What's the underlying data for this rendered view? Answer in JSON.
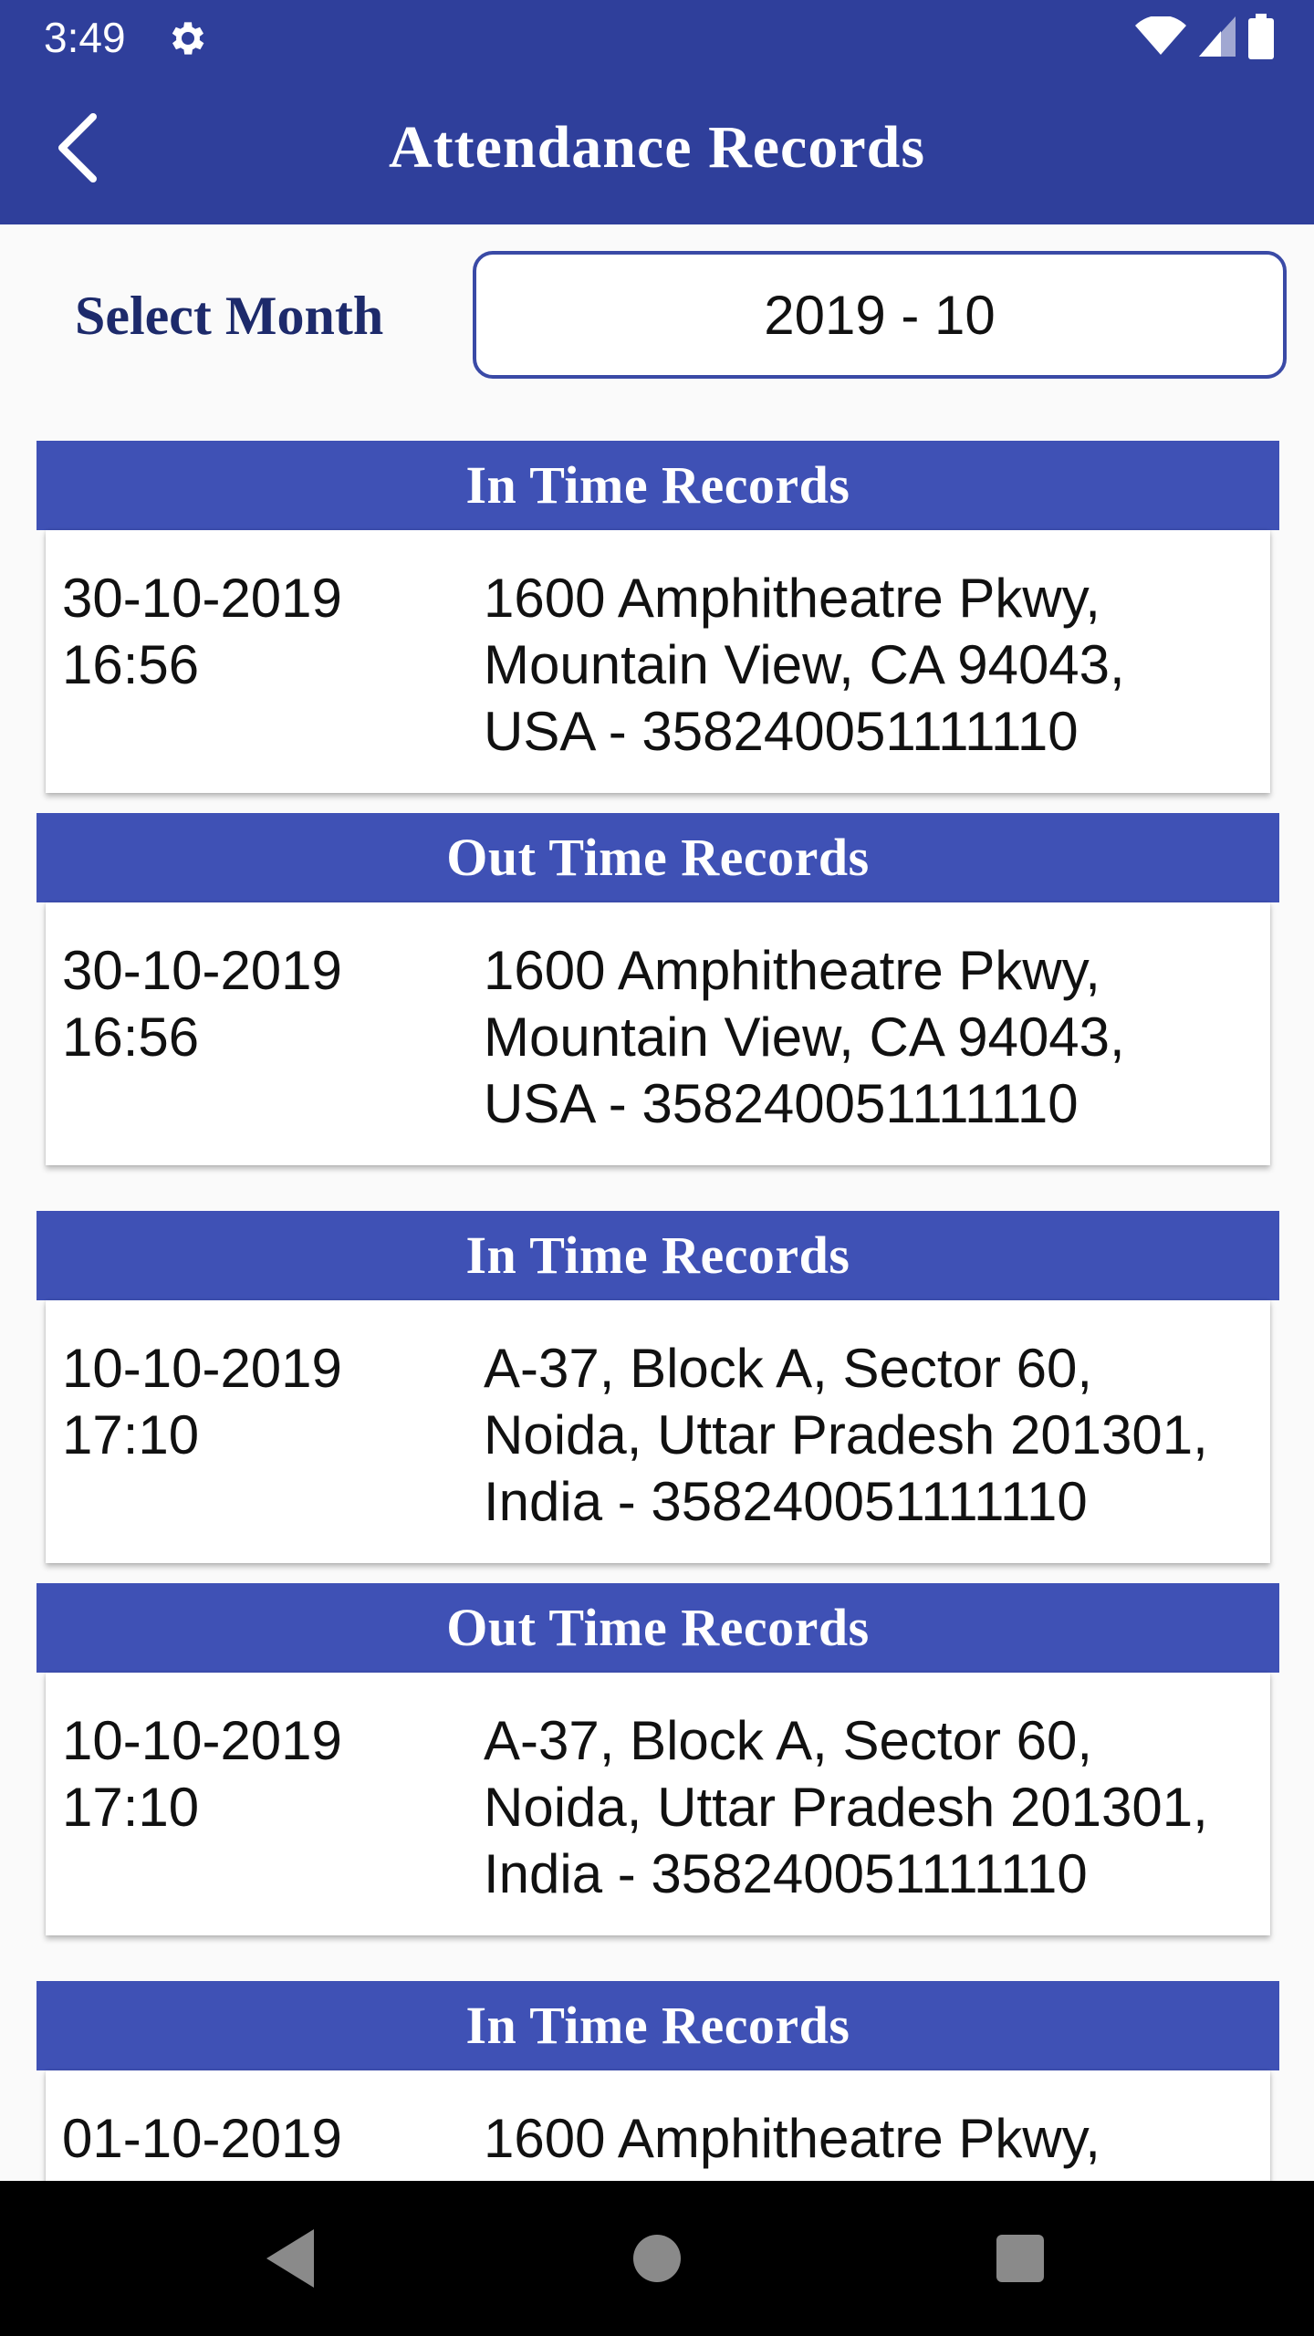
{
  "status_bar": {
    "time": "3:49",
    "icons": [
      "gear-icon",
      "wifi-icon",
      "cell-signal-icon",
      "battery-icon"
    ]
  },
  "app_bar": {
    "title": "Attendance Records",
    "back_icon": "chevron-left-icon"
  },
  "month_selector": {
    "label": "Select Month",
    "value": "2019 - 10"
  },
  "records": [
    {
      "header": "In Time Records",
      "date": "30-10-2019",
      "time": "16:56",
      "address_lines": [
        "1600 Amphitheatre Pkwy,",
        "Mountain View, CA 94043,",
        "USA - 358240051111110"
      ]
    },
    {
      "header": "Out Time Records",
      "date": "30-10-2019",
      "time": "16:56",
      "address_lines": [
        "1600 Amphitheatre Pkwy,",
        "Mountain View, CA 94043,",
        "USA - 358240051111110"
      ]
    },
    {
      "header": "In Time Records",
      "date": "10-10-2019",
      "time": "17:10",
      "address_lines": [
        "A-37, Block A, Sector 60,",
        "Noida, Uttar Pradesh 201301,",
        "India - 358240051111110"
      ]
    },
    {
      "header": "Out Time Records",
      "date": "10-10-2019",
      "time": "17:10",
      "address_lines": [
        "A-37, Block A, Sector 60,",
        "Noida, Uttar Pradesh 201301,",
        "India - 358240051111110"
      ]
    },
    {
      "header": "In Time Records",
      "date": "01-10-2019",
      "time": "",
      "address_lines": [
        "1600 Amphitheatre Pkwy,",
        "",
        ""
      ]
    }
  ],
  "colors": {
    "primary_dark": "#2f3f9b",
    "primary": "#3f51b5",
    "label_text": "#1d2a6b",
    "background": "#fafafa"
  },
  "nav_bar": {
    "icons": [
      "back-triangle-icon",
      "home-circle-icon",
      "recents-square-icon"
    ]
  }
}
